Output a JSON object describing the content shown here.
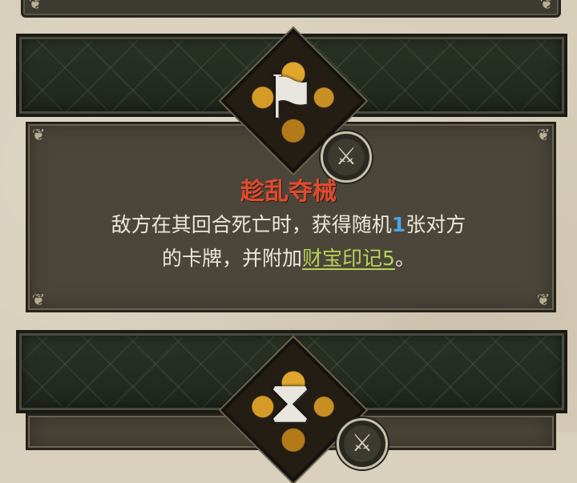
{
  "card": {
    "title": "趁乱夺械",
    "emblem_icon": "banner-flag-icon",
    "badge_icon": "sword-shield-icon",
    "description": {
      "part1": "敌方在其回合死亡时，获得随机",
      "number": "1",
      "part2": "张对方",
      "part3": "的卡牌，并附加",
      "term": "财宝印记5",
      "end": "。"
    }
  },
  "next_card": {
    "emblem_icon": "hourglass-icon"
  },
  "colors": {
    "title": "#e04b2f",
    "number": "#4aa3e8",
    "term": "#b7d35a",
    "text": "#ece7d9",
    "panel": "#4c463a",
    "banner": "#2b3327"
  }
}
